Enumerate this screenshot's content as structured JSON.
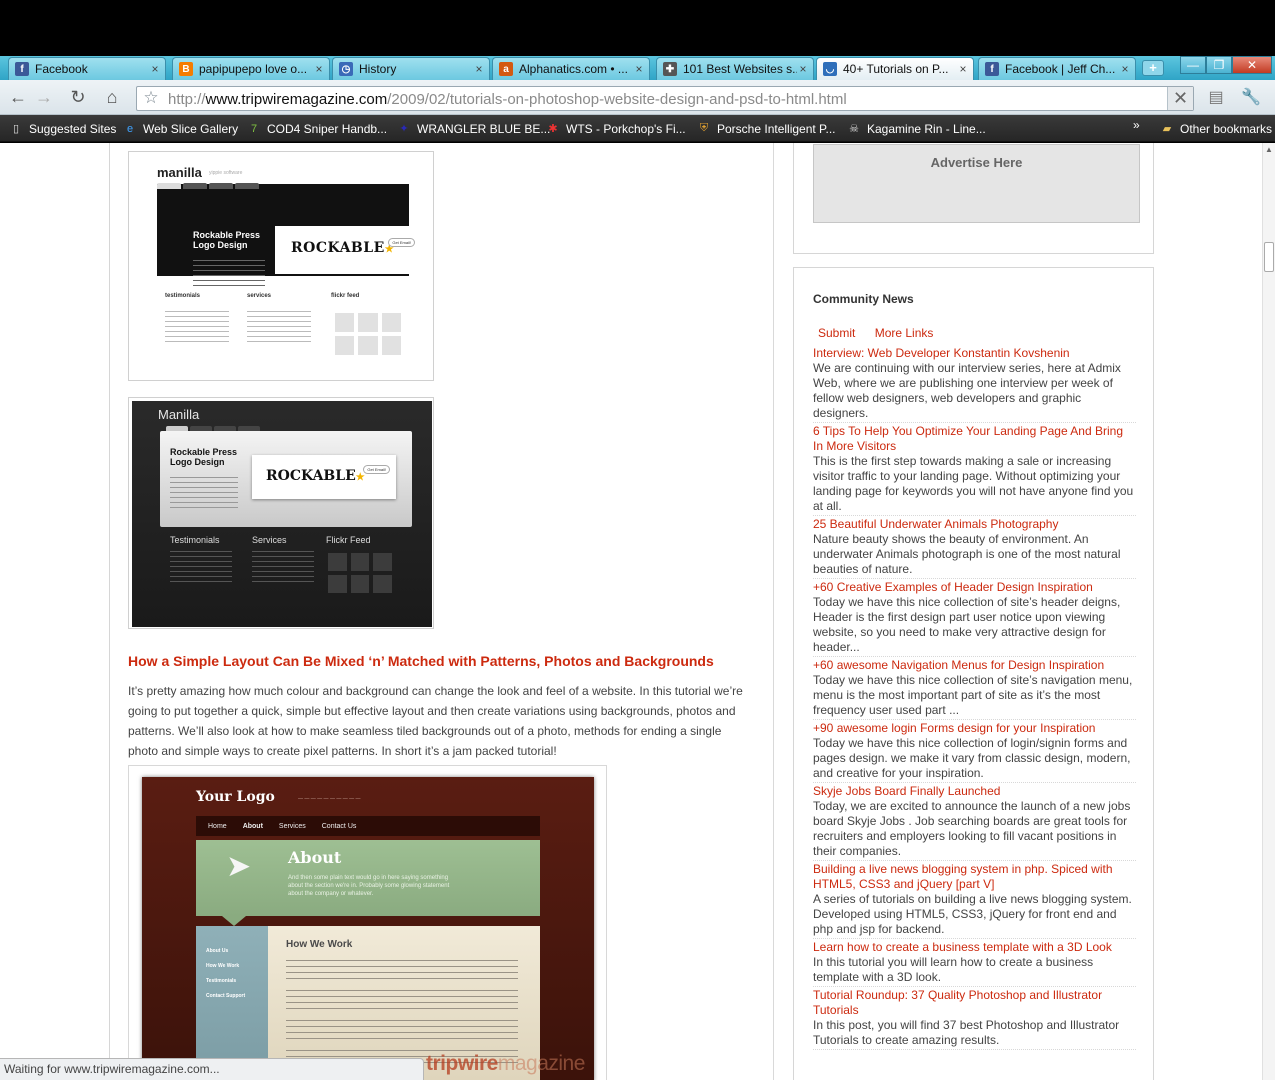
{
  "tabs": [
    {
      "label": "Facebook",
      "icon": "facebook-icon",
      "color": "#3b5998",
      "glyph": "f",
      "active": false
    },
    {
      "label": "papipupepo love o...",
      "icon": "blogger-icon",
      "color": "#f57d00",
      "glyph": "B",
      "active": false
    },
    {
      "label": "History",
      "icon": "history-icon",
      "color": "#3a6ab8",
      "glyph": "◷",
      "active": false
    },
    {
      "label": "Alphanatics.com • ...",
      "icon": "alphanatics-icon",
      "color": "#d35a12",
      "glyph": "a",
      "active": false
    },
    {
      "label": "101 Best Websites s...",
      "icon": "plus-cross-icon",
      "color": "#555555",
      "glyph": "✚",
      "active": false
    },
    {
      "label": "40+ Tutorials on P...",
      "icon": "loading-icon",
      "color": "#2f6fba",
      "glyph": "◡",
      "active": true
    },
    {
      "label": "Facebook | Jeff Ch...",
      "icon": "facebook-icon",
      "color": "#3b5998",
      "glyph": "f",
      "active": false
    }
  ],
  "window_controls": {
    "minimize": "—",
    "maximize": "❐",
    "close": "✕"
  },
  "toolbar": {
    "url_scheme": "http://",
    "url_host": "www.tripwiremagazine.com",
    "url_path": "/2009/02/tutorials-on-photoshop-website-design-and-psd-to-html.html"
  },
  "bookmarks": [
    {
      "label": "Suggested Sites",
      "icon": "page-icon",
      "glyph": "▯"
    },
    {
      "label": "Web Slice Gallery",
      "icon": "ie-icon",
      "glyph": "e"
    },
    {
      "label": "COD4 Sniper Handb...",
      "icon": "seven-icon",
      "glyph": "7"
    },
    {
      "label": "WRANGLER BLUE BE...",
      "icon": "wrangler-icon",
      "glyph": "✦"
    },
    {
      "label": "WTS - Porkchop's Fi...",
      "icon": "forum-icon",
      "glyph": "✱"
    },
    {
      "label": "Porsche Intelligent P...",
      "icon": "porsche-icon",
      "glyph": "⛨"
    },
    {
      "label": "Kagamine Rin - Line...",
      "icon": "skull-icon",
      "glyph": "☠"
    }
  ],
  "other_bookmarks": "Other bookmarks",
  "article": {
    "shot1": {
      "title": "manilla",
      "subtitle": "yippie software",
      "heading_line1": "Rockable Press",
      "heading_line2": "Logo Design",
      "brand": "ROCKABLE",
      "badge": "Get Email!",
      "col1": "testimonials",
      "col2": "services",
      "col3": "flickr feed"
    },
    "shot2": {
      "title": "Manilla",
      "heading_line1": "Rockable Press",
      "heading_line2": "Logo Design",
      "brand": "ROCKABLE",
      "badge": "Get Email!",
      "col1": "Testimonials",
      "col2": "Services",
      "col3": "Flickr Feed"
    },
    "post_title": "How a Simple Layout Can Be Mixed ‘n’ Matched with Patterns, Photos and Backgrounds",
    "post_body": "It’s pretty amazing how much colour and background can change the look and feel of a website. In this tutorial we’re going to put together a quick, simple but effective layout and then create variations using backgrounds, photos and patterns. We’ll also look at how to make seamless tiled backgrounds out of a photo, methods for ending a single photo and simple ways to create pixel patterns. In short it’s a jam packed tutorial!",
    "shot3": {
      "logo": "Your Logo",
      "nav": [
        "Home",
        "About",
        "Services",
        "Contact Us"
      ],
      "hero_title": "About",
      "hero_text": "And then some plain text would go in here saying something about the section we're in. Probably some glowing statement about the company or whatever.",
      "side_links": [
        "About Us",
        "How We Work",
        "Testimonials",
        "Contact Support"
      ],
      "section_title": "How We Work"
    },
    "watermark_bold": "tripwire",
    "watermark_light": "magazine"
  },
  "sidebar": {
    "advertise": "Advertise Here",
    "news_heading": "Community News",
    "links": [
      "Submit",
      "More Links"
    ],
    "news": [
      {
        "title": "Interview: Web Developer Konstantin Kovshenin",
        "desc": "We are continuing with our interview series, here at Admix Web, where we are publishing one interview per week of fellow web designers, web developers and graphic designers."
      },
      {
        "title": "6 Tips To Help You Optimize Your Landing Page And Bring In More Visitors",
        "desc": "This is the first step towards making a sale or increasing visitor traffic to your landing page. Without optimizing your landing page for keywords you will not have anyone find you at all."
      },
      {
        "title": "25 Beautiful Underwater Animals Photography",
        "desc": "Nature beauty shows the beauty of environment. An underwater Animals photograph is one of the most natural beauties of nature."
      },
      {
        "title": "+60 Creative Examples of Header Design Inspiration",
        "desc": "Today we have this nice collection of site’s header deigns, Header is the first design part user notice upon viewing website, so you need to make very attractive design for header..."
      },
      {
        "title": "+60 awesome Navigation Menus for Design Inspiration",
        "desc": "Today we have this nice collection of site’s navigation menu, menu is the most important part of site as it’s the most frequency user used part ..."
      },
      {
        "title": "+90 awesome login Forms design for your Inspiration",
        "desc": "Today we have this nice collection of login/signin forms and pages design. we make it vary from classic design, modern, and creative for your inspiration."
      },
      {
        "title": "Skyje Jobs Board Finally Launched",
        "desc": "Today, we are excited to announce the launch of a new jobs board Skyje Jobs . Job searching boards are great tools for recruiters and employers looking to fill vacant positions in their companies."
      },
      {
        "title": "Building a live news blogging system in php. Spiced with HTML5, CSS3 and jQuery [part V]",
        "desc": "A series of tutorials on building a live news blogging system. Developed using HTML5, CSS3, jQuery for front end and php and jsp for backend."
      },
      {
        "title": "Learn how to create a business template with a 3D Look",
        "desc": "In this tutorial you will learn how to create a business template with a 3D look."
      },
      {
        "title": "Tutorial Roundup: 37 Quality Photoshop and Illustrator Tutorials",
        "desc": "In this post, you will find 37 best Photoshop and Illustrator Tutorials to create amazing results."
      }
    ]
  },
  "status": "Waiting for www.tripwiremagazine.com..."
}
